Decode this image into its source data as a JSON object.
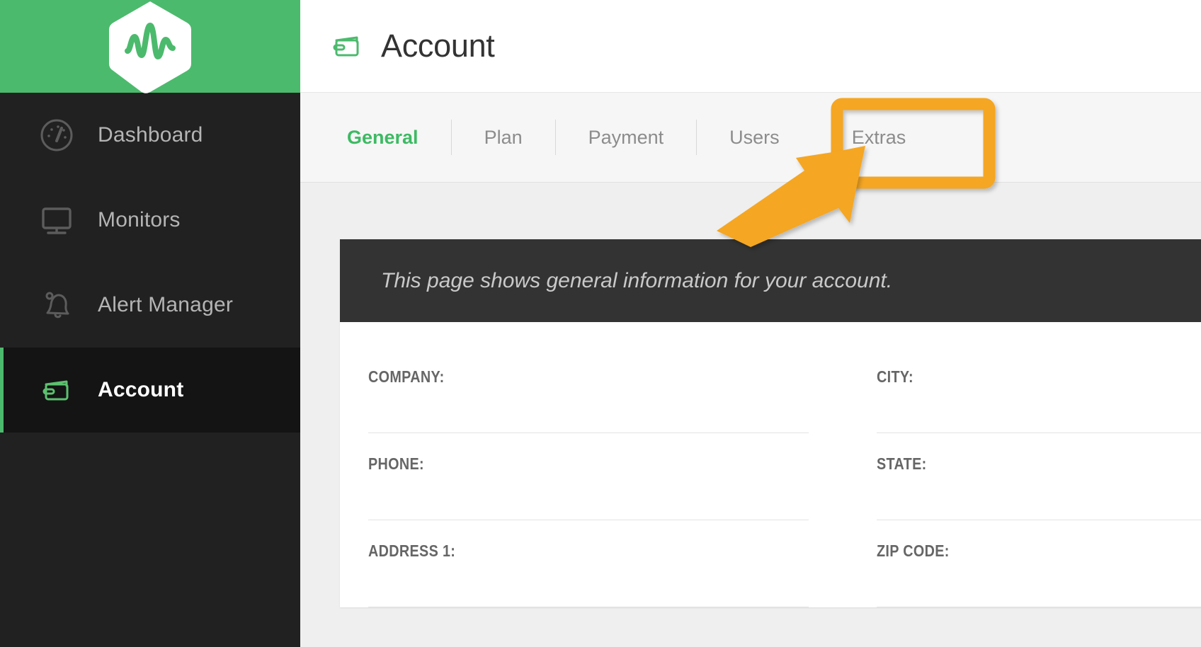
{
  "brand": {
    "logo_icon": "hexagon-pulse-logo",
    "header_color": "#4cba6d",
    "accent_color": "#4cba6d"
  },
  "sidebar": {
    "items": [
      {
        "label": "Dashboard",
        "icon": "speedometer-icon",
        "active": false
      },
      {
        "label": "Monitors",
        "icon": "monitor-icon",
        "active": false
      },
      {
        "label": "Alert Manager",
        "icon": "bell-icon",
        "active": false
      },
      {
        "label": "Account",
        "icon": "wallet-icon",
        "active": true
      }
    ]
  },
  "header": {
    "icon": "wallet-icon",
    "title": "Account"
  },
  "tabs": [
    {
      "label": "General",
      "active": true
    },
    {
      "label": "Plan",
      "active": false
    },
    {
      "label": "Payment",
      "active": false
    },
    {
      "label": "Users",
      "active": false
    },
    {
      "label": "Extras",
      "active": false
    }
  ],
  "card": {
    "description": "This page shows general information for your account.",
    "fields": [
      {
        "label": "COMPANY:",
        "value": "",
        "placeholder": ""
      },
      {
        "label": "CITY:",
        "value": "",
        "placeholder": ""
      },
      {
        "label": "PHONE:",
        "value": "",
        "placeholder": ""
      },
      {
        "label": "STATE:",
        "value": "",
        "placeholder": ""
      },
      {
        "label": "ADDRESS 1:",
        "value": "",
        "placeholder": ""
      },
      {
        "label": "ZIP CODE:",
        "value": "",
        "placeholder": ""
      }
    ]
  },
  "annotation": {
    "color": "#f5a623",
    "highlight_target": "Extras",
    "shapes": [
      "highlight-rectangle",
      "pointer-arrow"
    ]
  }
}
